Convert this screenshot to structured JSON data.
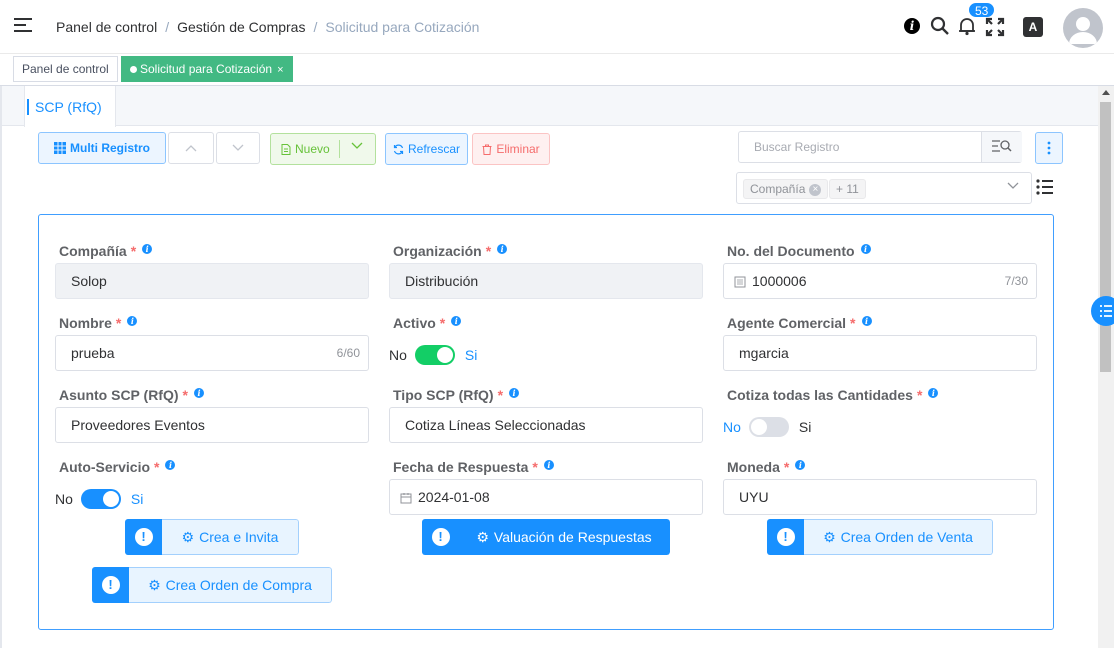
{
  "breadcrumb": [
    "Panel de control",
    "Gestión de Compras",
    "Solicitud para Cotización"
  ],
  "header": {
    "notifications_count": "53",
    "language_label": "A"
  },
  "tags": {
    "home": "Panel de control",
    "active": "Solicitud para Cotización",
    "close": "×"
  },
  "tab": {
    "label": "SCP (RfQ)"
  },
  "toolbar": {
    "multi_record": "Multi Registro",
    "new": "Nuevo",
    "refresh": "Refrescar",
    "delete": "Eliminar",
    "search_placeholder": "Buscar Registro",
    "filter_chip": "Compañía",
    "filter_more": "+ 11"
  },
  "form": {
    "company": {
      "label": "Compañía",
      "value": "Solop"
    },
    "organization": {
      "label": "Organización",
      "value": "Distribución"
    },
    "document_no": {
      "label": "No. del Documento",
      "value": "1000006",
      "count": "7/30"
    },
    "name": {
      "label": "Nombre",
      "value": "prueba",
      "count": "6/60"
    },
    "active": {
      "label": "Activo",
      "off": "No",
      "on": "Si",
      "value": true
    },
    "sales_rep": {
      "label": "Agente Comercial",
      "value": "mgarcia"
    },
    "rfq_topic": {
      "label": "Asunto SCP (RfQ)",
      "value": "Proveedores Eventos"
    },
    "rfq_type": {
      "label": "Tipo SCP (RfQ)",
      "value": "Cotiza Líneas Seleccionadas"
    },
    "quote_all_qty": {
      "label": "Cotiza todas las Cantidades",
      "off": "No",
      "on": "Si",
      "value": false
    },
    "self_service": {
      "label": "Auto-Servicio",
      "off": "No",
      "on": "Si",
      "value": true
    },
    "date_response": {
      "label": "Fecha de Respuesta",
      "value": "2024-01-08"
    },
    "currency": {
      "label": "Moneda",
      "value": "UYU"
    }
  },
  "actions": {
    "create_invite": "Crea e Invita",
    "rank_responses": "Valuación de Respuestas",
    "create_sales_order": "Crea Orden de Venta",
    "create_purchase_order": "Crea Orden de Compra"
  },
  "colors": {
    "primary": "#1890ff",
    "success": "#13ce66",
    "tag_active": "#42b983",
    "danger": "#f56c6c"
  }
}
